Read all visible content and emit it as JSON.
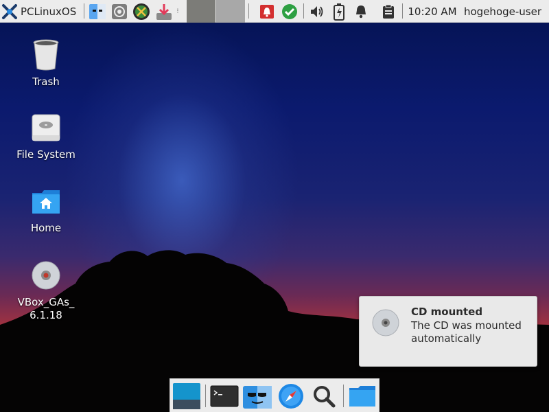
{
  "top_panel": {
    "menu_label": "PCLinuxOS",
    "clock": "10:20 AM",
    "user": "hogehoge-user",
    "launchers": [
      "finder-face-icon",
      "system-settings-icon",
      "xfce-tools-icon",
      "download-icon"
    ],
    "tray": [
      "notification-alert-icon",
      "update-check-icon",
      "volume-icon",
      "battery-icon",
      "bell-icon",
      "clipboard-icon"
    ]
  },
  "desktop": {
    "icons": [
      {
        "label": "Trash",
        "icon": "trash-icon"
      },
      {
        "label": "File System",
        "icon": "drive-icon"
      },
      {
        "label": "Home",
        "icon": "home-folder-icon"
      },
      {
        "label": "VBox_GAs_\n6.1.18",
        "line1": "VBox_GAs_",
        "line2": "6.1.18",
        "icon": "cd-icon"
      }
    ]
  },
  "notification": {
    "title": "CD mounted",
    "body": "The CD was mounted automatically",
    "icon": "cd-icon"
  },
  "dock": {
    "items": [
      "show-desktop-icon",
      "terminal-icon",
      "file-manager-icon",
      "web-browser-icon",
      "search-icon",
      "folder-icon"
    ]
  },
  "colors": {
    "panel_bg": "#ececec",
    "accent_blue": "#1e88e5",
    "alert_red": "#d32f2f",
    "ok_green": "#2ea043"
  }
}
